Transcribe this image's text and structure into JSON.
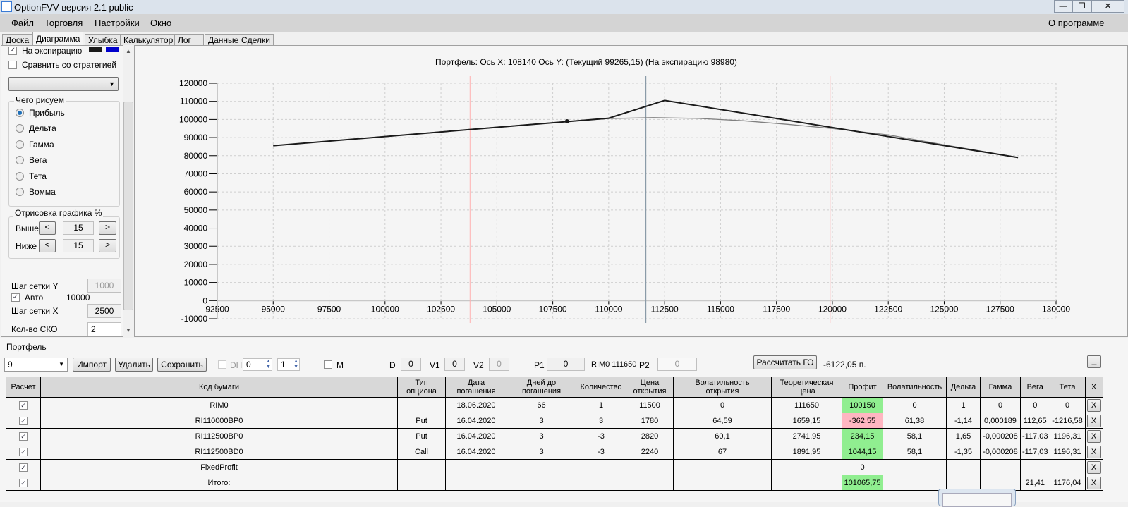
{
  "window": {
    "title": "OptionFVV версия 2.1 public",
    "minimize": "—",
    "restore": "❐",
    "close": "✕"
  },
  "menu": {
    "items": [
      "Файл",
      "Торговля",
      "Настройки",
      "Окно"
    ],
    "about": "О программе"
  },
  "tabs": [
    "Доска",
    "Диаграмма",
    "Улыбка",
    "Калькулятор",
    "Лог",
    "Данные",
    "Сделки"
  ],
  "active_tab": "Диаграмма",
  "left": {
    "on_expiry": "На экспирацию",
    "on_expiry_checked": true,
    "colors": [
      "#1a1a1a",
      "#0000cc"
    ],
    "compare": "Сравнить со стратегией",
    "compare_checked": false,
    "strategy_select": "",
    "draw_group": "Чего рисуем",
    "radios": [
      "Прибыль",
      "Дельта",
      "Гамма",
      "Вега",
      "Тета",
      "Вомма"
    ],
    "selected_radio": "Прибыль",
    "render_group": "Отрисовка графика %",
    "above_label": "Выше",
    "above_value": "15",
    "below_label": "Ниже",
    "below_value": "15",
    "prev": "<",
    "next": ">",
    "grid_y_label": "Шаг сетки Y",
    "grid_y_value": "1000",
    "auto_label": "Авто",
    "auto_checked": true,
    "auto_value": "10000",
    "grid_x_label": "Шаг сетки X",
    "grid_x_value": "2500",
    "sko_label": "Кол-во СКО",
    "sko_value": "2"
  },
  "chart_data": {
    "type": "line",
    "title": "Портфель: Ось X: 108140 Ось Y:  (Текущий 99265,15)  (На экспирацию 98980)",
    "xlim": [
      92500,
      130000
    ],
    "ylim": [
      -10000,
      120000
    ],
    "x_ticks": [
      92500,
      95000,
      97500,
      100000,
      102500,
      105000,
      107500,
      110000,
      112500,
      115000,
      117500,
      120000,
      122500,
      125000,
      127500,
      130000
    ],
    "y_ticks": [
      120000,
      110000,
      100000,
      90000,
      80000,
      70000,
      60000,
      50000,
      40000,
      30000,
      20000,
      10000,
      0,
      -10000
    ],
    "grid": true,
    "series": [
      {
        "color": "#1a1a1a",
        "points": [
          [
            95000,
            85500
          ],
          [
            110000,
            100700
          ],
          [
            112500,
            110500
          ],
          [
            128300,
            79000
          ]
        ]
      },
      {
        "color": "#808080",
        "points": [
          [
            95000,
            85500
          ],
          [
            100000,
            90600
          ],
          [
            105000,
            95800
          ],
          [
            108140,
            98900
          ],
          [
            110000,
            100500
          ],
          [
            112000,
            101000
          ],
          [
            114000,
            100600
          ],
          [
            116000,
            99300
          ],
          [
            118000,
            97300
          ],
          [
            120000,
            95000
          ],
          [
            122500,
            91500
          ],
          [
            125000,
            86000
          ],
          [
            128300,
            79000
          ]
        ]
      }
    ],
    "marker": [
      108140,
      98980
    ],
    "vlines": [
      {
        "x": 103800,
        "color": "#ffb0b0"
      },
      {
        "x": 111650,
        "color": "#8a9ba8"
      },
      {
        "x": 119900,
        "color": "#ffb0b0"
      }
    ]
  },
  "portfolio": {
    "label": "Портфель",
    "select": "9",
    "import": "Импорт",
    "delete": "Удалить",
    "save": "Сохранить",
    "dh": "DH",
    "dh_checked": false,
    "spin1": "0",
    "spin2": "1",
    "m": "M",
    "m_checked": false,
    "d_label": "D",
    "d": "0",
    "v1_label": "V1",
    "v1": "0",
    "v2_label": "V2",
    "v2": "0",
    "p1_label": "P1",
    "p1": "0",
    "rim": "RIM0 111650",
    "p2_label": "P2",
    "p2": "0",
    "calc_go": "Рассчитать ГО",
    "go_value": "-6122,05 п.",
    "collapse": "_"
  },
  "table": {
    "headers": [
      "Расчет",
      "Код бумаги",
      "Тип\nопциона",
      "Дата\nпогашения",
      "Дней до\nпогашения",
      "Количество",
      "Цена\nоткрытия",
      "Волатильность\nоткрытия",
      "Теоретическая\nцена",
      "Профит",
      "Волатильность",
      "Дельта",
      "Гамма",
      "Вега",
      "Тета",
      "X"
    ],
    "rows": [
      {
        "code": "RIM0",
        "type": "",
        "date": "18.06.2020",
        "days": "66",
        "qty": "1",
        "open": "11500",
        "vol_open": "0",
        "theor": "111650",
        "profit": "100150",
        "pcolor": "green",
        "vol": "0",
        "delta": "1",
        "gamma": "0",
        "vega": "0",
        "theta": "0"
      },
      {
        "code": "RI110000BP0",
        "type": "Put",
        "date": "16.04.2020",
        "days": "3",
        "qty": "3",
        "open": "1780",
        "vol_open": "64,59",
        "theor": "1659,15",
        "profit": "-362,55",
        "pcolor": "pink",
        "vol": "61,38",
        "delta": "-1,14",
        "gamma": "0,000189",
        "vega": "112,65",
        "theta": "-1216,58"
      },
      {
        "code": "RI112500BP0",
        "type": "Put",
        "date": "16.04.2020",
        "days": "3",
        "qty": "-3",
        "open": "2820",
        "vol_open": "60,1",
        "theor": "2741,95",
        "profit": "234,15",
        "pcolor": "green",
        "vol": "58,1",
        "delta": "1,65",
        "gamma": "-0,000208",
        "vega": "-117,03",
        "theta": "1196,31"
      },
      {
        "code": "RI112500BD0",
        "type": "Call",
        "date": "16.04.2020",
        "days": "3",
        "qty": "-3",
        "open": "2240",
        "vol_open": "67",
        "theor": "1891,95",
        "profit": "1044,15",
        "pcolor": "green",
        "vol": "58,1",
        "delta": "-1,35",
        "gamma": "-0,000208",
        "vega": "-117,03",
        "theta": "1196,31"
      },
      {
        "code": "FixedProfit",
        "type": "",
        "date": "",
        "days": "",
        "qty": "",
        "open": "",
        "vol_open": "",
        "theor": "",
        "profit": "0",
        "pcolor": "",
        "vol": "",
        "delta": "",
        "gamma": "",
        "vega": "",
        "theta": ""
      },
      {
        "code": "Итого:",
        "type": "",
        "date": "",
        "days": "",
        "qty": "",
        "open": "",
        "vol_open": "",
        "theor": "",
        "profit": "101065,75",
        "pcolor": "green",
        "vol": "",
        "delta": "",
        "gamma": "",
        "vega": "21,41",
        "theta": "1176,04"
      }
    ],
    "x_label": "X"
  }
}
